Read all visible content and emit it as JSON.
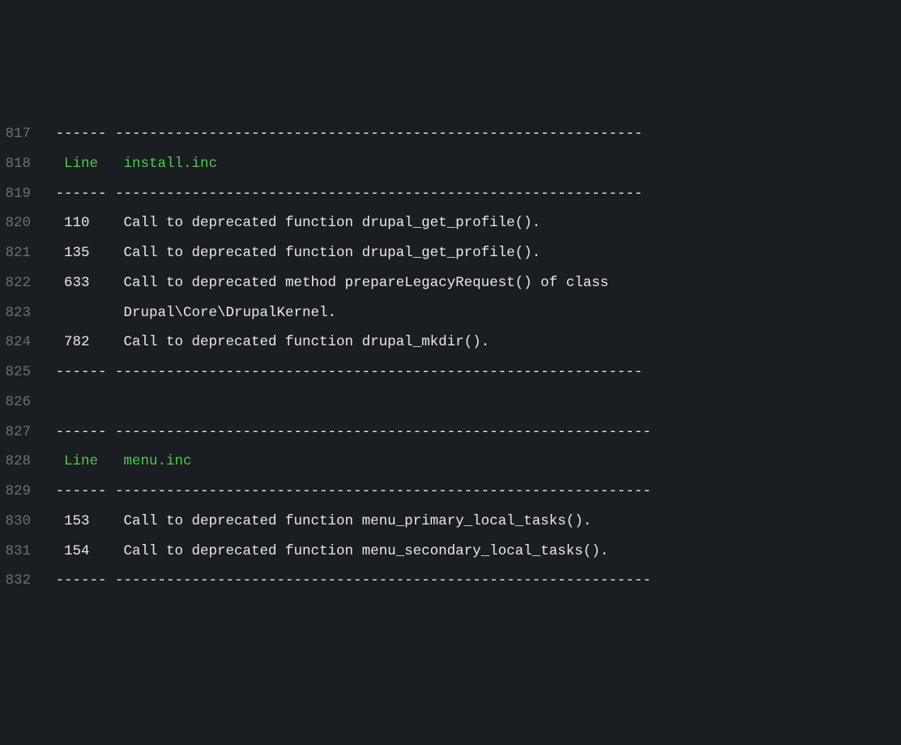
{
  "lines": [
    {
      "no": "817",
      "segments": [
        {
          "text": " ------ -------------------------------------------------------------- ",
          "cls": "white"
        }
      ]
    },
    {
      "no": "818",
      "segments": [
        {
          "text": "  ",
          "cls": "white"
        },
        {
          "text": "Line",
          "cls": "green"
        },
        {
          "text": "   ",
          "cls": "white"
        },
        {
          "text": "install.inc",
          "cls": "green"
        },
        {
          "text": "                                                     ",
          "cls": "white"
        }
      ]
    },
    {
      "no": "819",
      "segments": [
        {
          "text": " ------ -------------------------------------------------------------- ",
          "cls": "white"
        }
      ]
    },
    {
      "no": "820",
      "segments": [
        {
          "text": "  110    Call to deprecated function drupal_get_profile().              ",
          "cls": "white"
        }
      ]
    },
    {
      "no": "821",
      "segments": [
        {
          "text": "  135    Call to deprecated function drupal_get_profile().              ",
          "cls": "white"
        }
      ]
    },
    {
      "no": "822",
      "segments": [
        {
          "text": "  633    Call to deprecated method prepareLegacyRequest() of class      ",
          "cls": "white"
        }
      ]
    },
    {
      "no": "823",
      "segments": [
        {
          "text": "         Drupal\\Core\\DrupalKernel.                                      ",
          "cls": "white"
        }
      ]
    },
    {
      "no": "824",
      "segments": [
        {
          "text": "  782    Call to deprecated function drupal_mkdir().                    ",
          "cls": "white"
        }
      ]
    },
    {
      "no": "825",
      "segments": [
        {
          "text": " ------ -------------------------------------------------------------- ",
          "cls": "white"
        }
      ]
    },
    {
      "no": "826",
      "segments": [
        {
          "text": "",
          "cls": "white"
        }
      ]
    },
    {
      "no": "827",
      "segments": [
        {
          "text": " ------ --------------------------------------------------------------- ",
          "cls": "white"
        }
      ]
    },
    {
      "no": "828",
      "segments": [
        {
          "text": "  ",
          "cls": "white"
        },
        {
          "text": "Line",
          "cls": "green"
        },
        {
          "text": "   ",
          "cls": "white"
        },
        {
          "text": "menu.inc",
          "cls": "green"
        },
        {
          "text": "                                                         ",
          "cls": "white"
        }
      ]
    },
    {
      "no": "829",
      "segments": [
        {
          "text": " ------ --------------------------------------------------------------- ",
          "cls": "white"
        }
      ]
    },
    {
      "no": "830",
      "segments": [
        {
          "text": "  153    Call to deprecated function menu_primary_local_tasks().         ",
          "cls": "white"
        }
      ]
    },
    {
      "no": "831",
      "segments": [
        {
          "text": "  154    Call to deprecated function menu_secondary_local_tasks().       ",
          "cls": "white"
        }
      ]
    },
    {
      "no": "832",
      "segments": [
        {
          "text": " ------ --------------------------------------------------------------- ",
          "cls": "white"
        }
      ]
    }
  ]
}
